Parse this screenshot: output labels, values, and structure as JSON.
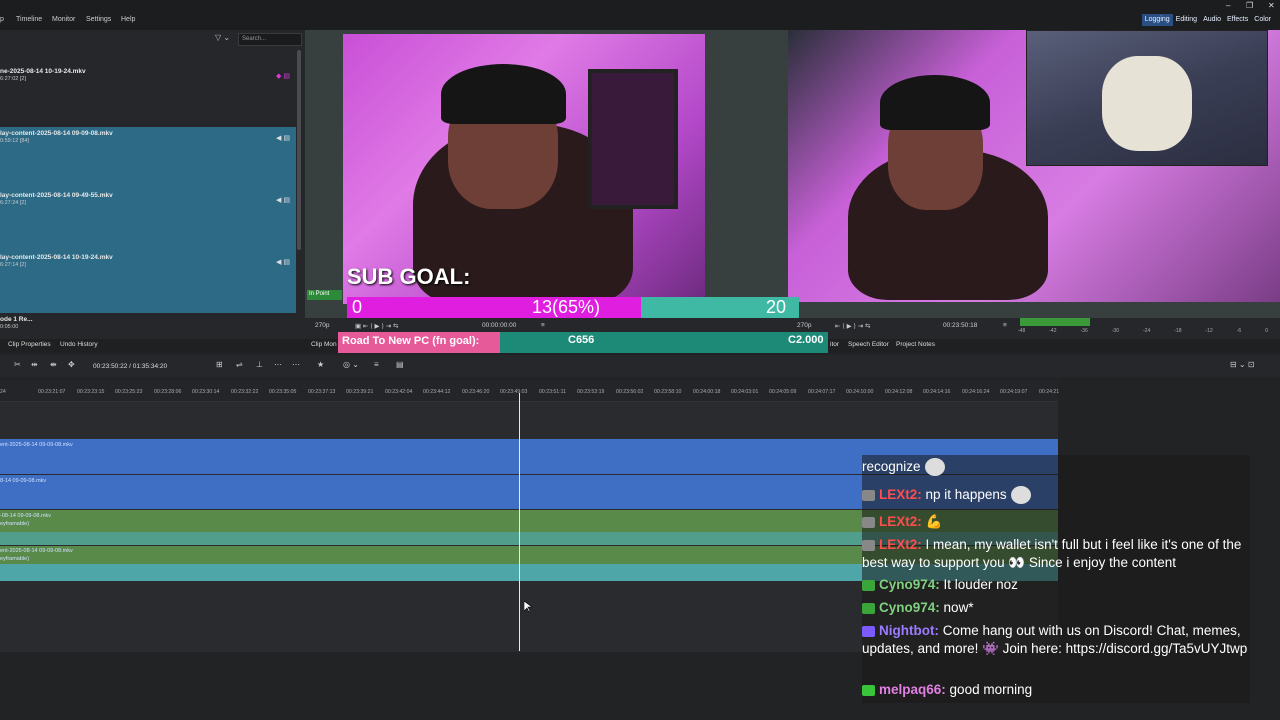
{
  "menu": [
    "p",
    "Timeline",
    "Monitor",
    "Settings",
    "Help"
  ],
  "window_controls": [
    "–",
    "❐",
    "✕"
  ],
  "workspaces": [
    {
      "label": "Logging",
      "active": true
    },
    {
      "label": "Editing",
      "active": false
    },
    {
      "label": "Audio",
      "active": false
    },
    {
      "label": "Effects",
      "active": false
    },
    {
      "label": "Color",
      "active": false
    }
  ],
  "bin": {
    "search_placeholder": "Search...",
    "items": [
      {
        "name": "ne-2025-08-14 10-19-24.mkv",
        "duration": "6:27:02 [2]",
        "selected": false
      },
      {
        "name": "lay-content-2025-08-14 09-09-08.mkv",
        "duration": "0:59:12 [84]",
        "selected": true
      },
      {
        "name": "lay-content-2025-08-14 09-49-55.mkv",
        "duration": "6:27:24 [2]",
        "selected": true
      },
      {
        "name": "lay-content-2025-08-14 10-19-24.mkv",
        "duration": "6:27:14 [2]",
        "selected": true
      },
      {
        "name": "ode 1 Re...",
        "duration": "0:05:00",
        "selected": false
      }
    ]
  },
  "overlay": {
    "sub_goal_label": "SUB GOAL:",
    "progress_start": "0",
    "progress_mid": "13(65%)",
    "progress_end": "20",
    "progress_fraction": 0.65,
    "road_label": "Road To New PC (fn goal):",
    "road_start": "C656",
    "road_end": "C2.000"
  },
  "monitor": {
    "in_point_label": "In Point",
    "left_zoom": "270p",
    "left_timecode": "00:00:00:00",
    "right_zoom": "270p",
    "right_timecode": "00:23:50:18",
    "meter_ticks": [
      "-48",
      "-42",
      "-36",
      "-30",
      "-24",
      "-18",
      "-12",
      "-6",
      "0"
    ]
  },
  "tabs": {
    "clip_properties": "Clip Properties",
    "undo_history": "Undo History",
    "clip_monitor": "Clip Mon",
    "editor": "itor",
    "speech_editor": "Speech Editor",
    "project_notes": "Project Notes"
  },
  "timeline": {
    "position": "00:23:50:22 / 01:35:34:20",
    "ruler": [
      "24",
      "00:23:21:07",
      "00:23:23:15",
      "00:23:25:23",
      "00:23:28:06",
      "00:23:30:14",
      "00:23:32:22",
      "00:23:35:05",
      "00:23:37:13",
      "00:23:39:21",
      "00:23:42:04",
      "00:23:44:12",
      "00:23:46:20",
      "00:23:49:03",
      "00:23:51:11",
      "00:23:53:19",
      "00:23:56:02",
      "00:23:58:10",
      "00:24:00:18",
      "00:24:03:01",
      "00:24:05:09",
      "00:24:07:17",
      "00:24:10:00",
      "00:24:12:08",
      "00:24:14:16",
      "00:24:16:24",
      "00:24:19:07",
      "00:24:21"
    ],
    "tracks": [
      {
        "label": "ent-2025-08-14 09-09-08.mkv",
        "kind": "video"
      },
      {
        "label": "8-14 09-09-08.mkv",
        "kind": "video"
      },
      {
        "label": "-08-14 09-09-08.mkv",
        "sublabel": "eyframable)",
        "kind": "audio"
      },
      {
        "label": "ent-2025-08-14 09-09-08.mkv",
        "sublabel": "eyframable)",
        "kind": "audio"
      }
    ]
  },
  "chat": [
    {
      "user": "",
      "text": "recognize",
      "color": "#ffffff",
      "badge": "",
      "emote": true
    },
    {
      "user": "LEXt2:",
      "text": "np it happens",
      "color": "#ff4d4d",
      "badge": "#888888",
      "emote": true
    },
    {
      "user": "LEXt2:",
      "text": "💪",
      "color": "#ff4d4d",
      "badge": "#888888",
      "emote": false
    },
    {
      "user": "LEXt2:",
      "text": "I mean, my wallet isn't full but i feel like it's one of the best way to support you 👀 Since i enjoy the content",
      "color": "#ff4d4d",
      "badge": "#888888",
      "emote": false
    },
    {
      "user": "Cyno974:",
      "text": "It louder noz",
      "color": "#7fd17f",
      "badge": "#3aa63a",
      "emote": false
    },
    {
      "user": "Cyno974:",
      "text": "now*",
      "color": "#7fd17f",
      "badge": "#3aa63a",
      "emote": false
    },
    {
      "user": "Nightbot:",
      "text": "Come hang out with us on Discord! Chat, memes, updates, and more! 👾 Join here: https://discord.gg/Ta5vUYJtwp",
      "color": "#9b7bff",
      "badge": "#7b5bff",
      "emote": false
    },
    {
      "user": "melpaq66:",
      "text": "good morning",
      "color": "#e27fe2",
      "badge": "#3ac43a",
      "emote": false
    }
  ]
}
